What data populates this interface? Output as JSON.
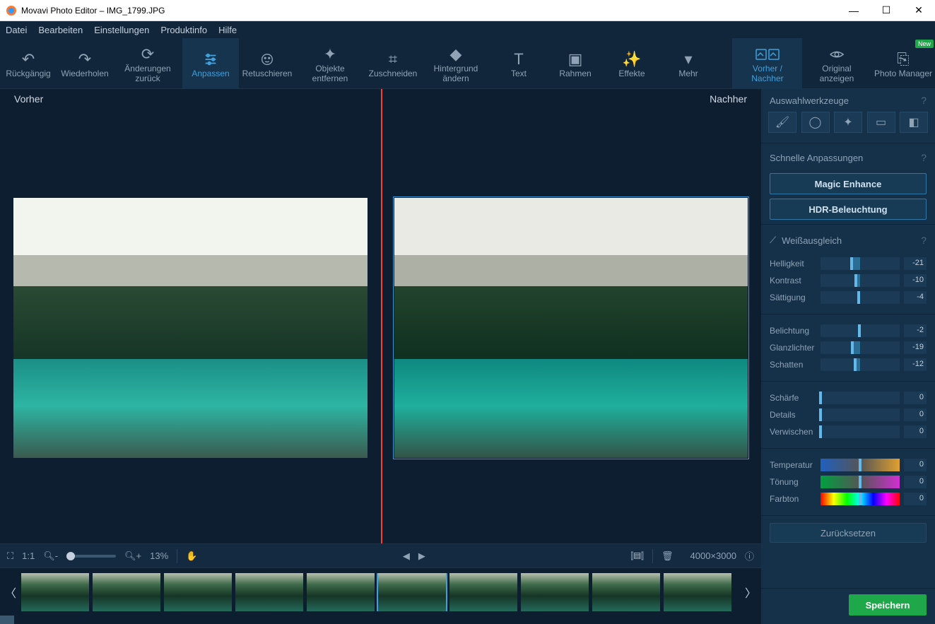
{
  "window": {
    "title": "Movavi Photo Editor – IMG_1799.JPG"
  },
  "menu": [
    "Datei",
    "Bearbeiten",
    "Einstellungen",
    "Produktinfo",
    "Hilfe"
  ],
  "toolbar": {
    "undo": "Rückgängig",
    "redo": "Wiederholen",
    "revert": "Änderungen zurück",
    "adjust": "Anpassen",
    "retouch": "Retuschieren",
    "remove_obj": "Objekte entfernen",
    "crop": "Zuschneiden",
    "bg": "Hintergrund ändern",
    "text": "Text",
    "frame": "Rahmen",
    "effects": "Effekte",
    "more": "Mehr",
    "before_after": "Vorher / Nachher",
    "original": "Original anzeigen",
    "photo_manager": "Photo Manager",
    "new_badge": "New"
  },
  "preview": {
    "before": "Vorher",
    "after": "Nachher"
  },
  "status": {
    "zoom_pct": "13%",
    "onetoone": "1:1",
    "dimensions": "4000×3000"
  },
  "film_count": 10,
  "side": {
    "selection_title": "Auswahlwerkzeuge",
    "quick_title": "Schnelle Anpassungen",
    "magic": "Magic Enhance",
    "hdr": "HDR-Beleuchtung",
    "wb": "Weißausgleich",
    "reset": "Zurücksetzen",
    "save": "Speichern",
    "sliders": {
      "group1": [
        {
          "label": "Helligkeit",
          "value": -21,
          "min": -100,
          "max": 100
        },
        {
          "label": "Kontrast",
          "value": -10,
          "min": -100,
          "max": 100
        },
        {
          "label": "Sättigung",
          "value": -4,
          "min": -100,
          "max": 100
        }
      ],
      "group2": [
        {
          "label": "Belichtung",
          "value": -2,
          "min": -100,
          "max": 100
        },
        {
          "label": "Glanzlichter",
          "value": -19,
          "min": -100,
          "max": 100
        },
        {
          "label": "Schatten",
          "value": -12,
          "min": -100,
          "max": 100
        }
      ],
      "group3": [
        {
          "label": "Schärfe",
          "value": 0,
          "min": 0,
          "max": 100
        },
        {
          "label": "Details",
          "value": 0,
          "min": 0,
          "max": 100
        },
        {
          "label": "Verwischen",
          "value": 0,
          "min": 0,
          "max": 100
        }
      ],
      "group4": [
        {
          "label": "Temperatur",
          "value": 0,
          "min": -100,
          "max": 100,
          "style": "temp"
        },
        {
          "label": "Tönung",
          "value": 0,
          "min": -100,
          "max": 100,
          "style": "tint"
        },
        {
          "label": "Farbton",
          "value": 0,
          "min": -100,
          "max": 100,
          "style": "hue"
        }
      ]
    }
  }
}
